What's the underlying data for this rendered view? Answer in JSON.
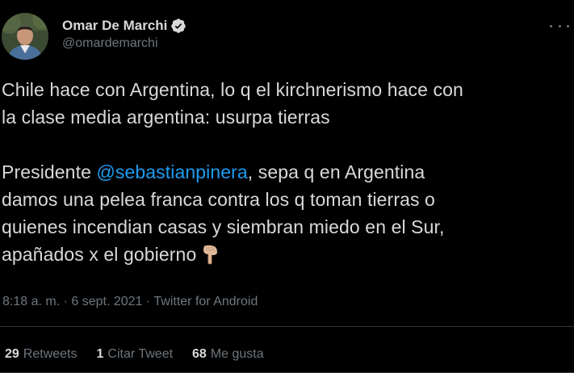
{
  "author": {
    "name": "Omar De Marchi",
    "handle": "@omardemarchi"
  },
  "tweet": {
    "line1": "Chile hace con Argentina, lo q el kirchnerismo hace con",
    "line2": "la clase media argentina: usurpa tierras",
    "p2_prefix": "Presidente ",
    "mention": "@sebastianpinera",
    "p2_line1_suffix": ", sepa q en Argentina",
    "p2_line2": "damos una pelea franca contra los q toman tierras o",
    "p2_line3": "quienes incendian casas y siembran miedo en el Sur,",
    "p2_line4": "apañados x el gobierno",
    "emoji": "backhand-index-pointing-down"
  },
  "meta": {
    "time": "8:18 a. m.",
    "dot1": " · ",
    "date": "6 sept. 2021",
    "dot2": " · ",
    "source": "Twitter for Android"
  },
  "stats": {
    "retweets_count": "29",
    "retweets_label": "Retweets",
    "quotes_count": "1",
    "quotes_label": "Citar Tweet",
    "likes_count": "68",
    "likes_label": "Me gusta"
  },
  "colors": {
    "background": "#000000",
    "text": "#d9d9d9",
    "secondary": "#6e767d",
    "link": "#1d9bf0",
    "divider": "#2f3336"
  }
}
